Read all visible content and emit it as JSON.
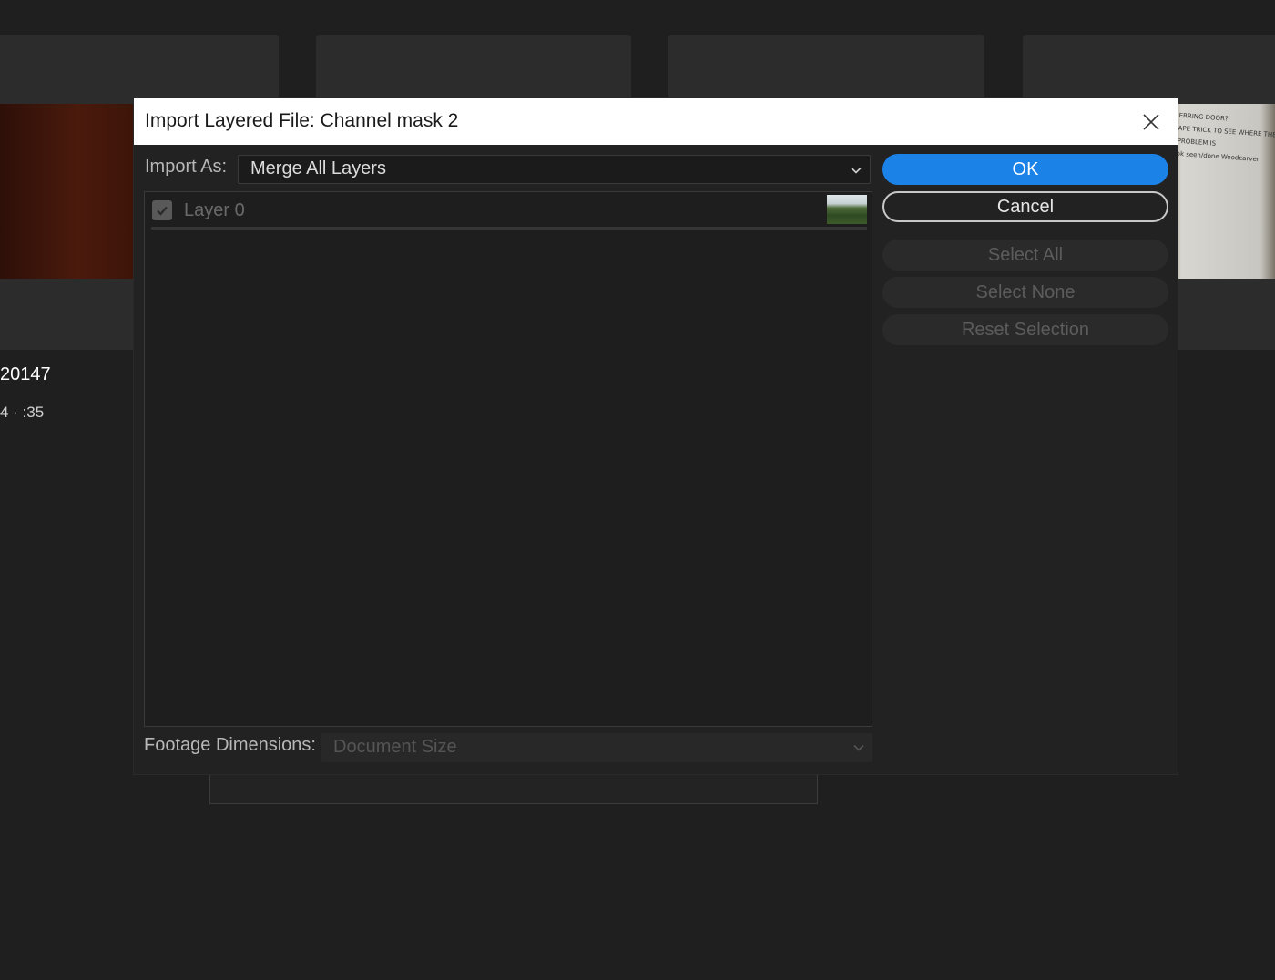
{
  "background": {
    "item_title": "20147",
    "item_meta": "4 · :35",
    "note_lines": [
      "ERRING DOOR?",
      "APE TRICK TO SEE WHERE THE PROBLEM IS",
      "ok seen/done Woodcarver"
    ]
  },
  "dialog": {
    "title": "Import Layered File: Channel mask 2",
    "close_icon": "close-icon",
    "import_as": {
      "label": "Import As:",
      "value": "Merge All Layers"
    },
    "layers": [
      {
        "name": "Layer 0",
        "checked": true,
        "enabled": false
      }
    ],
    "buttons": {
      "ok": "OK",
      "cancel": "Cancel",
      "select_all": "Select All",
      "select_none": "Select None",
      "reset_selection": "Reset Selection"
    },
    "footage_dimensions": {
      "label": "Footage Dimensions:",
      "value": "Document Size"
    },
    "colors": {
      "accent": "#1b82e8",
      "dialog_bg": "#222222",
      "titlebar_bg": "#ffffff"
    }
  }
}
